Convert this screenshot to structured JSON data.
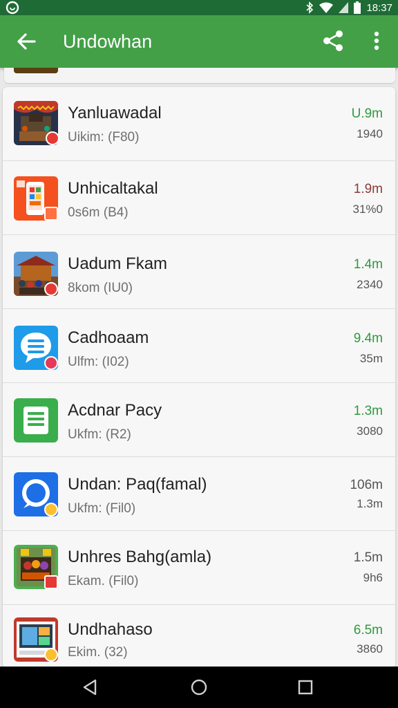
{
  "status_bar": {
    "time": "18:37"
  },
  "app_bar": {
    "title": "Undowhan"
  },
  "colors": {
    "primary": "#43a047",
    "status": "#1f6b35",
    "green_text": "#2e9a3e",
    "red_text": "#8c3a3a"
  },
  "apps": [
    {
      "name": "Yanluawadal",
      "sub": "Uikim: (F80)",
      "size": "U.9m",
      "count": "1940"
    },
    {
      "name": "Unhicaltakal",
      "sub": "0s6m (B4)",
      "size": "1.9m",
      "count": "31%0"
    },
    {
      "name": "Uadum Fkam",
      "sub": "8kom (IU0)",
      "size": "1.4m",
      "count": "2340"
    },
    {
      "name": "Cadhoaam",
      "sub": "Ulfm: (I02)",
      "size": "9.4m",
      "count": "35m"
    },
    {
      "name": "Acdnar Pacy",
      "sub": "Ukfm: (R2)",
      "size": "1.3m",
      "count": "3080"
    },
    {
      "name": "Undan: Paq(famal)",
      "sub": "Ukfm: (Fil0)",
      "size": "106m",
      "count": "1.3m"
    },
    {
      "name": "Unhres Bahg(amla)",
      "sub": "Ekam. (Fil0)",
      "size": "1.5m",
      "count": "9h6"
    },
    {
      "name": "Undhahaso",
      "sub": "Ekim. (32)",
      "size": "6.5m",
      "count": "3860"
    }
  ]
}
